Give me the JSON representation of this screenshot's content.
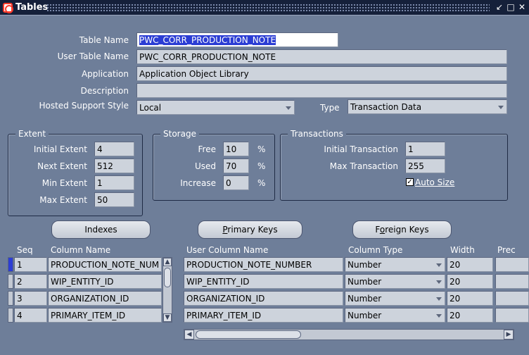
{
  "window": {
    "title": "Tables"
  },
  "form": {
    "table_name_label": "Table Name",
    "table_name": "PWC_CORR_PRODUCTION_NOTE",
    "user_table_name_label": "User Table Name",
    "user_table_name": "PWC_CORR_PRODUCTION_NOTE",
    "application_label": "Application",
    "application": "Application Object Library",
    "description_label": "Description",
    "description": "",
    "hosted_support_label": "Hosted Support Style",
    "hosted_support": "Local",
    "type_label": "Type",
    "type": "Transaction Data"
  },
  "extent": {
    "title": "Extent",
    "initial_label": "Initial Extent",
    "initial": "4",
    "next_label": "Next Extent",
    "next": "512",
    "min_label": "Min Extent",
    "min": "1",
    "max_label": "Max Extent",
    "max": "50"
  },
  "storage": {
    "title": "Storage",
    "free_label": "Free",
    "free": "10",
    "used_label": "Used",
    "used": "70",
    "increase_label": "Increase",
    "increase": "0",
    "pct": "%"
  },
  "transactions": {
    "title": "Transactions",
    "initial_label": "Initial Transaction",
    "initial": "1",
    "max_label": "Max Transaction",
    "max": "255",
    "auto_size_label": "Auto Size",
    "auto_size_checked": true
  },
  "buttons": {
    "indexes": "Indexes",
    "primary_keys_u": "P",
    "primary_keys_rest": "rimary Keys",
    "foreign_keys_pre": "F",
    "foreign_keys_u": "o",
    "foreign_keys_rest": "reign Keys"
  },
  "grid": {
    "headers": {
      "seq": "Seq",
      "column_name": "Column Name",
      "user_column_name": "User Column Name",
      "column_type": "Column Type",
      "width": "Width",
      "precision": "Prec"
    },
    "rows": [
      {
        "seq": "1",
        "column_name": "PRODUCTION_NOTE_NUM",
        "user_column_name": "PRODUCTION_NOTE_NUMBER",
        "column_type": "Number",
        "width": "20"
      },
      {
        "seq": "2",
        "column_name": "WIP_ENTITY_ID",
        "user_column_name": "WIP_ENTITY_ID",
        "column_type": "Number",
        "width": "20"
      },
      {
        "seq": "3",
        "column_name": "ORGANIZATION_ID",
        "user_column_name": "ORGANIZATION_ID",
        "column_type": "Number",
        "width": "20"
      },
      {
        "seq": "4",
        "column_name": "PRIMARY_ITEM_ID",
        "user_column_name": "PRIMARY_ITEM_ID",
        "column_type": "Number",
        "width": "20"
      }
    ]
  },
  "icons": [
    "oracle-logo-icon",
    "minimize-icon",
    "maximize-icon",
    "close-icon",
    "checkbox-icon",
    "scroll-up-icon",
    "scroll-down-icon",
    "scroll-left-icon",
    "scroll-right-icon",
    "dropdown-arrow-icon"
  ]
}
